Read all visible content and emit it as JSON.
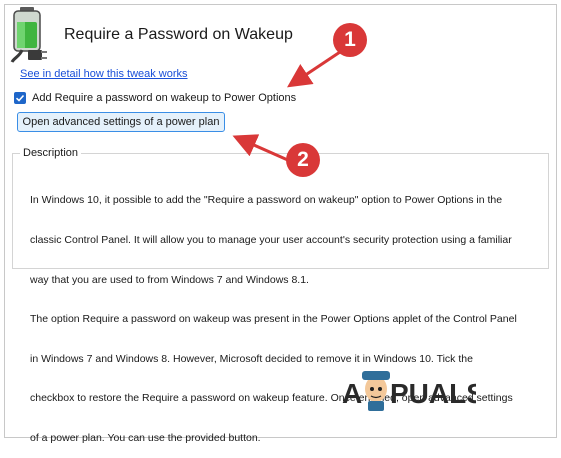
{
  "window": {
    "title": "Require a Password on Wakeup",
    "icon": "battery-plug-icon"
  },
  "link_text": "See in detail how this tweak works",
  "checkbox": {
    "label": "Add Require a password on wakeup to Power Options",
    "checked": true
  },
  "button_label": "Open advanced settings of a power plan",
  "description": {
    "legend": "Description",
    "lines": [
      "In Windows 10, it possible to add the \"Require a password on wakeup\" option to Power Options in the",
      "classic Control Panel. It will allow you to manage your user account's security protection using a familiar",
      "way that you are used to from Windows 7 and Windows 8.1.",
      "The option Require a password on wakeup was present in the Power Options applet of the Control Panel",
      "in Windows 7 and Windows 8. However, Microsoft decided to remove it in Windows 10. Tick the",
      "checkbox to restore the Require a password on wakeup feature. Once enabled, open advanced settings",
      "of a power plan. You can use the provided button."
    ]
  },
  "annotations": [
    {
      "label": "1"
    },
    {
      "label": "2"
    }
  ],
  "watermark": {
    "left": "A",
    "right": "PUALS"
  },
  "colors": {
    "accent": "#1e66c9",
    "link": "#1a4fd8",
    "marker": "#d93838",
    "button_bg": "#e5f1fb"
  }
}
